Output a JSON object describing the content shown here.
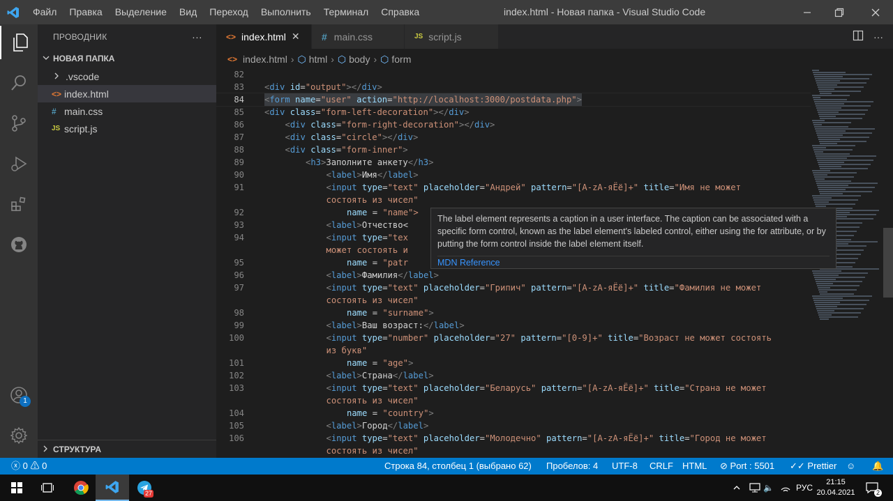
{
  "titlebar": {
    "menu": [
      "Файл",
      "Правка",
      "Выделение",
      "Вид",
      "Переход",
      "Выполнить",
      "Терминал",
      "Справка"
    ],
    "title": "index.html - Новая папка - Visual Studio Code"
  },
  "activity": {
    "accounts_badge": "1"
  },
  "sidebar": {
    "header": "ПРОВОДНИК",
    "more": "···",
    "folder": "НОВАЯ ПАПКА",
    "items": [
      {
        "label": ".vscode",
        "icon": "chevron-right-icon"
      },
      {
        "label": "index.html",
        "icon": "html-file-icon"
      },
      {
        "label": "main.css",
        "icon": "css-file-icon"
      },
      {
        "label": "script.js",
        "icon": "js-file-icon"
      }
    ],
    "outline": "СТРУКТУРА"
  },
  "tabs": [
    {
      "label": "index.html",
      "close": "✕"
    },
    {
      "label": "main.css"
    },
    {
      "label": "script.js"
    }
  ],
  "breadcrumb": [
    "index.html",
    "html",
    "body",
    "form"
  ],
  "editor": {
    "lines": [
      {
        "n": "82",
        "segs": []
      },
      {
        "n": "83",
        "segs": [
          [
            "punct",
            "<"
          ],
          [
            "tag",
            "div"
          ],
          [
            "attr",
            " id"
          ],
          [
            "txt",
            "="
          ],
          [
            "str",
            "\"output\""
          ],
          [
            "punct",
            ">"
          ],
          [
            "punct",
            "</"
          ],
          [
            "tag",
            "div"
          ],
          [
            "punct",
            ">"
          ]
        ]
      },
      {
        "n": "84",
        "segs": [
          [
            "punct",
            "<"
          ],
          [
            "tag",
            "form"
          ],
          [
            "attr",
            " name"
          ],
          [
            "txt",
            "="
          ],
          [
            "str",
            "\"user\""
          ],
          [
            "attr",
            " action"
          ],
          [
            "txt",
            "="
          ],
          [
            "str",
            "\"http://localhost:3000/postdata.php\""
          ],
          [
            "punct",
            ">"
          ]
        ]
      },
      {
        "n": "85",
        "segs": [
          [
            "punct",
            "<"
          ],
          [
            "tag",
            "div"
          ],
          [
            "attr",
            " class"
          ],
          [
            "txt",
            "="
          ],
          [
            "str",
            "\"form-left-decoration\""
          ],
          [
            "punct",
            ">"
          ],
          [
            "punct",
            "</"
          ],
          [
            "tag",
            "div"
          ],
          [
            "punct",
            ">"
          ]
        ]
      },
      {
        "n": "86",
        "indent": 1,
        "segs": [
          [
            "punct",
            "<"
          ],
          [
            "tag",
            "div"
          ],
          [
            "attr",
            " class"
          ],
          [
            "txt",
            "="
          ],
          [
            "str",
            "\"form-right-decoration\""
          ],
          [
            "punct",
            ">"
          ],
          [
            "punct",
            "</"
          ],
          [
            "tag",
            "div"
          ],
          [
            "punct",
            ">"
          ]
        ]
      },
      {
        "n": "87",
        "indent": 1,
        "segs": [
          [
            "punct",
            "<"
          ],
          [
            "tag",
            "div"
          ],
          [
            "attr",
            " class"
          ],
          [
            "txt",
            "="
          ],
          [
            "str",
            "\"circle\""
          ],
          [
            "punct",
            ">"
          ],
          [
            "punct",
            "</"
          ],
          [
            "tag",
            "div"
          ],
          [
            "punct",
            ">"
          ]
        ]
      },
      {
        "n": "88",
        "indent": 1,
        "segs": [
          [
            "punct",
            "<"
          ],
          [
            "tag",
            "div"
          ],
          [
            "attr",
            " class"
          ],
          [
            "txt",
            "="
          ],
          [
            "str",
            "\"form-inner\""
          ],
          [
            "punct",
            ">"
          ]
        ]
      },
      {
        "n": "89",
        "indent": 2,
        "segs": [
          [
            "punct",
            "<"
          ],
          [
            "tag",
            "h3"
          ],
          [
            "punct",
            ">"
          ],
          [
            "txt",
            "Заполните анкету"
          ],
          [
            "punct",
            "</"
          ],
          [
            "tag",
            "h3"
          ],
          [
            "punct",
            ">"
          ]
        ]
      },
      {
        "n": "90",
        "indent": 3,
        "segs": [
          [
            "punct",
            "<"
          ],
          [
            "tag",
            "label"
          ],
          [
            "punct",
            ">"
          ],
          [
            "txt",
            "Имя"
          ],
          [
            "punct",
            "</"
          ],
          [
            "tag",
            "label"
          ],
          [
            "punct",
            ">"
          ]
        ]
      },
      {
        "n": "91",
        "indent": 3,
        "segs": [
          [
            "punct",
            "<"
          ],
          [
            "tag",
            "input"
          ],
          [
            "attr",
            " type"
          ],
          [
            "txt",
            "="
          ],
          [
            "str",
            "\"text\""
          ],
          [
            "attr",
            " placeholder"
          ],
          [
            "txt",
            "="
          ],
          [
            "str",
            "\"Андрей\""
          ],
          [
            "attr",
            " pattern"
          ],
          [
            "txt",
            "="
          ],
          [
            "str",
            "\"[A-zA-яЁё]+\""
          ],
          [
            "attr",
            " title"
          ],
          [
            "txt",
            "="
          ],
          [
            "str",
            "\"Имя не может"
          ]
        ]
      },
      {
        "n": "",
        "indent": 3,
        "segs": [
          [
            "str",
            "состоять из чисел\""
          ]
        ]
      },
      {
        "n": "92",
        "indent": 4,
        "segs": [
          [
            "attr",
            "name"
          ],
          [
            "txt",
            " = "
          ],
          [
            "str",
            "\"name\">"
          ]
        ]
      },
      {
        "n": "93",
        "indent": 3,
        "segs": [
          [
            "punct",
            "<"
          ],
          [
            "tag",
            "label"
          ],
          [
            "punct",
            ">"
          ],
          [
            "txt",
            "Отчество<"
          ]
        ]
      },
      {
        "n": "94",
        "indent": 3,
        "segs": [
          [
            "punct",
            "<"
          ],
          [
            "tag",
            "input"
          ],
          [
            "attr",
            " type"
          ],
          [
            "txt",
            "="
          ],
          [
            "str",
            "\"tex"
          ]
        ]
      },
      {
        "n": "",
        "indent": 3,
        "segs": [
          [
            "str",
            "может состоять и"
          ]
        ]
      },
      {
        "n": "95",
        "indent": 4,
        "segs": [
          [
            "attr",
            "name"
          ],
          [
            "txt",
            " = "
          ],
          [
            "str",
            "\"patr"
          ]
        ]
      },
      {
        "n": "96",
        "indent": 3,
        "segs": [
          [
            "punct",
            "<"
          ],
          [
            "tag",
            "label"
          ],
          [
            "punct",
            ">"
          ],
          [
            "txt",
            "Фамилия"
          ],
          [
            "punct",
            "</"
          ],
          [
            "tag",
            "label"
          ],
          [
            "punct",
            ">"
          ]
        ]
      },
      {
        "n": "97",
        "indent": 3,
        "segs": [
          [
            "punct",
            "<"
          ],
          [
            "tag",
            "input"
          ],
          [
            "attr",
            " type"
          ],
          [
            "txt",
            "="
          ],
          [
            "str",
            "\"text\""
          ],
          [
            "attr",
            " placeholder"
          ],
          [
            "txt",
            "="
          ],
          [
            "str",
            "\"Грипич\""
          ],
          [
            "attr",
            " pattern"
          ],
          [
            "txt",
            "="
          ],
          [
            "str",
            "\"[A-zA-яЁё]+\""
          ],
          [
            "attr",
            " title"
          ],
          [
            "txt",
            "="
          ],
          [
            "str",
            "\"Фамилия не может"
          ]
        ]
      },
      {
        "n": "",
        "indent": 3,
        "segs": [
          [
            "str",
            "состоять из чисел\""
          ]
        ]
      },
      {
        "n": "98",
        "indent": 4,
        "segs": [
          [
            "attr",
            "name"
          ],
          [
            "txt",
            " = "
          ],
          [
            "str",
            "\"surname\""
          ],
          [
            "punct",
            ">"
          ]
        ]
      },
      {
        "n": "99",
        "indent": 3,
        "segs": [
          [
            "punct",
            "<"
          ],
          [
            "tag",
            "label"
          ],
          [
            "punct",
            ">"
          ],
          [
            "txt",
            "Ваш возраст:"
          ],
          [
            "punct",
            "</"
          ],
          [
            "tag",
            "label"
          ],
          [
            "punct",
            ">"
          ]
        ]
      },
      {
        "n": "100",
        "indent": 3,
        "segs": [
          [
            "punct",
            "<"
          ],
          [
            "tag",
            "input"
          ],
          [
            "attr",
            " type"
          ],
          [
            "txt",
            "="
          ],
          [
            "str",
            "\"number\""
          ],
          [
            "attr",
            " placeholder"
          ],
          [
            "txt",
            "="
          ],
          [
            "str",
            "\"27\""
          ],
          [
            "attr",
            " pattern"
          ],
          [
            "txt",
            "="
          ],
          [
            "str",
            "\"[0-9]+\""
          ],
          [
            "attr",
            " title"
          ],
          [
            "txt",
            "="
          ],
          [
            "str",
            "\"Возраст не может состоять"
          ]
        ]
      },
      {
        "n": "",
        "indent": 3,
        "segs": [
          [
            "str",
            "из букв\""
          ]
        ]
      },
      {
        "n": "101",
        "indent": 4,
        "segs": [
          [
            "attr",
            "name"
          ],
          [
            "txt",
            " = "
          ],
          [
            "str",
            "\"age\""
          ],
          [
            "punct",
            ">"
          ]
        ]
      },
      {
        "n": "102",
        "indent": 3,
        "segs": [
          [
            "punct",
            "<"
          ],
          [
            "tag",
            "label"
          ],
          [
            "punct",
            ">"
          ],
          [
            "txt",
            "Страна"
          ],
          [
            "punct",
            "</"
          ],
          [
            "tag",
            "label"
          ],
          [
            "punct",
            ">"
          ]
        ]
      },
      {
        "n": "103",
        "indent": 3,
        "segs": [
          [
            "punct",
            "<"
          ],
          [
            "tag",
            "input"
          ],
          [
            "attr",
            " type"
          ],
          [
            "txt",
            "="
          ],
          [
            "str",
            "\"text\""
          ],
          [
            "attr",
            " placeholder"
          ],
          [
            "txt",
            "="
          ],
          [
            "str",
            "\"Беларусь\""
          ],
          [
            "attr",
            " pattern"
          ],
          [
            "txt",
            "="
          ],
          [
            "str",
            "\"[A-zA-яЁё]+\""
          ],
          [
            "attr",
            " title"
          ],
          [
            "txt",
            "="
          ],
          [
            "str",
            "\"Страна не может"
          ]
        ]
      },
      {
        "n": "",
        "indent": 3,
        "segs": [
          [
            "str",
            "состоять из чисел\""
          ]
        ]
      },
      {
        "n": "104",
        "indent": 4,
        "segs": [
          [
            "attr",
            "name"
          ],
          [
            "txt",
            " = "
          ],
          [
            "str",
            "\"country\""
          ],
          [
            "punct",
            ">"
          ]
        ]
      },
      {
        "n": "105",
        "indent": 3,
        "segs": [
          [
            "punct",
            "<"
          ],
          [
            "tag",
            "label"
          ],
          [
            "punct",
            ">"
          ],
          [
            "txt",
            "Город"
          ],
          [
            "punct",
            "</"
          ],
          [
            "tag",
            "label"
          ],
          [
            "punct",
            ">"
          ]
        ]
      },
      {
        "n": "106",
        "indent": 3,
        "segs": [
          [
            "punct",
            "<"
          ],
          [
            "tag",
            "input"
          ],
          [
            "attr",
            " type"
          ],
          [
            "txt",
            "="
          ],
          [
            "str",
            "\"text\""
          ],
          [
            "attr",
            " placeholder"
          ],
          [
            "txt",
            "="
          ],
          [
            "str",
            "\"Молодечно\""
          ],
          [
            "attr",
            " pattern"
          ],
          [
            "txt",
            "="
          ],
          [
            "str",
            "\"[A-zA-яЁё]+\""
          ],
          [
            "attr",
            " title"
          ],
          [
            "txt",
            "="
          ],
          [
            "str",
            "\"Город не может"
          ]
        ]
      },
      {
        "n": "",
        "indent": 3,
        "segs": [
          [
            "str",
            "состоять из чисел\""
          ]
        ]
      }
    ],
    "current_line": "84"
  },
  "hover": {
    "text": "The label element represents a caption in a user interface. The caption can be associated with a specific form control, known as the label element's labeled control, either using the for attribute, or by putting the form control inside the label element itself.",
    "link": "MDN Reference"
  },
  "statusbar": {
    "errors": "0",
    "warnings": "0",
    "position": "Строка 84, столбец 1 (выбрано 62)",
    "spaces": "Пробелов: 4",
    "encoding": "UTF-8",
    "eol": "CRLF",
    "language": "HTML",
    "port": "Port : 5501",
    "prettier": "Prettier"
  },
  "taskbar": {
    "telegram_badge": "27",
    "lang": "РУС",
    "time": "21:15",
    "date": "20.04.2021",
    "notif_count": "2"
  },
  "colors": {
    "accent": "#007acc",
    "tag": "#569cd6",
    "attr": "#9cdcfe",
    "string": "#ce9178"
  }
}
